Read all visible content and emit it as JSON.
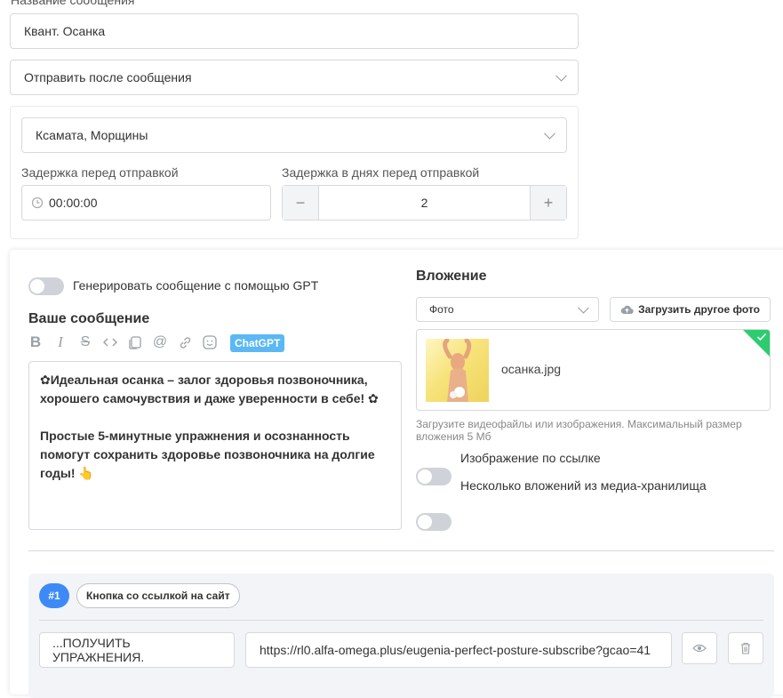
{
  "form": {
    "message_name_label": "Название сообщения",
    "message_name_value": "Квант. Осанка",
    "send_after_select": "Отправить после сообщения",
    "trigger_select": "Ксамата, Морщины",
    "delay_label": "Задержка перед отправкой",
    "delay_value": "00:00:00",
    "delay_days_label": "Задержка в днях перед отправкой",
    "delay_days_value": "2",
    "minus_symbol": "−",
    "plus_symbol": "+"
  },
  "editor": {
    "gpt_toggle_label": "Генерировать сообщение с помощью GPT",
    "your_message_title": "Ваше сообщение",
    "chatgpt_badge": "ChatGPT",
    "message_para1": "✿Идеальная осанка – залог здоровья позвоночника, хорошего самочувствия и даже уверенности в себе! ✿",
    "message_para2": "Простые 5-минутные упражнения и осознанность помогут сохранить здоровье позвоночника на долгие годы! 👆",
    "toolbar_icons": [
      "bold-icon",
      "italic-icon",
      "strikethrough-icon",
      "code-icon",
      "copy-icon",
      "mention-icon",
      "link-icon",
      "emoji-icon"
    ]
  },
  "attachment": {
    "title": "Вложение",
    "type_select": "Фото",
    "upload_button": "Загрузить другое фото",
    "file_name": "осанка.jpg",
    "hint": "Загрузите видеофайлы или изображения. Максимальный размер вложения 5 Мб",
    "image_by_link_label": "Изображение по ссылке",
    "multiple_attachments_label": "Несколько вложений из медиа-хранилища"
  },
  "button_block": {
    "number_badge": "#1",
    "type_chip": "Кнопка со ссылкой на сайт",
    "button_text_value": "...ПОЛУЧИТЬ УПРАЖНЕНИЯ.",
    "button_url_value": "https://rl0.alfa-omega.plus/eugenia-perfect-posture-subscribe?gcao=41"
  },
  "colors": {
    "accent_blue": "#3d8af7",
    "chatgpt_badge": "#5bb8f5",
    "success_green": "#2ecc71"
  }
}
